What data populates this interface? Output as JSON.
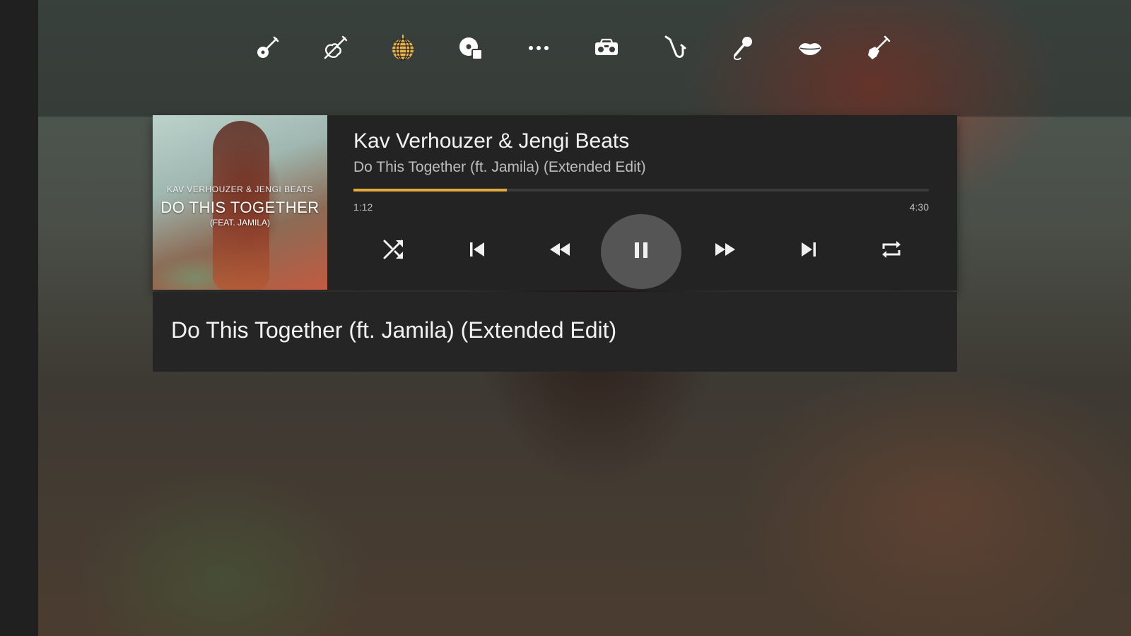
{
  "colors": {
    "accent": "#e3a93f",
    "panel": "#232323",
    "text_primary": "#f2f2f2",
    "text_secondary": "#bdbdbd",
    "play_button_bg": "#555555"
  },
  "genre_toolbar": {
    "items": [
      {
        "id": "acoustic",
        "icon": "acoustic-guitar-icon",
        "active": false
      },
      {
        "id": "classical",
        "icon": "violin-icon",
        "active": false
      },
      {
        "id": "disco",
        "icon": "disco-ball-icon",
        "active": true
      },
      {
        "id": "cd",
        "icon": "cd-disc-icon",
        "active": false
      },
      {
        "id": "more",
        "icon": "more-dots-icon",
        "active": false
      },
      {
        "id": "radio",
        "icon": "boombox-icon",
        "active": false
      },
      {
        "id": "jazz",
        "icon": "saxophone-icon",
        "active": false
      },
      {
        "id": "vocal",
        "icon": "microphone-icon",
        "active": false
      },
      {
        "id": "pop",
        "icon": "lips-icon",
        "active": false
      },
      {
        "id": "rock",
        "icon": "electric-guitar-icon",
        "active": false
      }
    ]
  },
  "album_art": {
    "artist_line": "KAV VERHOUZER & JENGI BEATS",
    "title_line": "DO THIS TOGETHER",
    "feat_line": "(FEAT. JAMILA)"
  },
  "now_playing": {
    "artist": "Kav Verhouzer & Jengi Beats",
    "track": "Do This Together (ft. Jamila) (Extended Edit)",
    "elapsed": "1:12",
    "duration": "4:30",
    "progress_fraction": 0.267
  },
  "controls": [
    {
      "id": "shuffle",
      "icon": "shuffle-icon"
    },
    {
      "id": "previous",
      "icon": "skip-previous-icon"
    },
    {
      "id": "rewind",
      "icon": "rewind-icon"
    },
    {
      "id": "pause",
      "icon": "pause-icon"
    },
    {
      "id": "fast_forward",
      "icon": "fast-forward-icon"
    },
    {
      "id": "next",
      "icon": "skip-next-icon"
    },
    {
      "id": "repeat",
      "icon": "repeat-icon"
    }
  ],
  "title_panel": {
    "title": "Do This Together (ft. Jamila) (Extended Edit)"
  }
}
